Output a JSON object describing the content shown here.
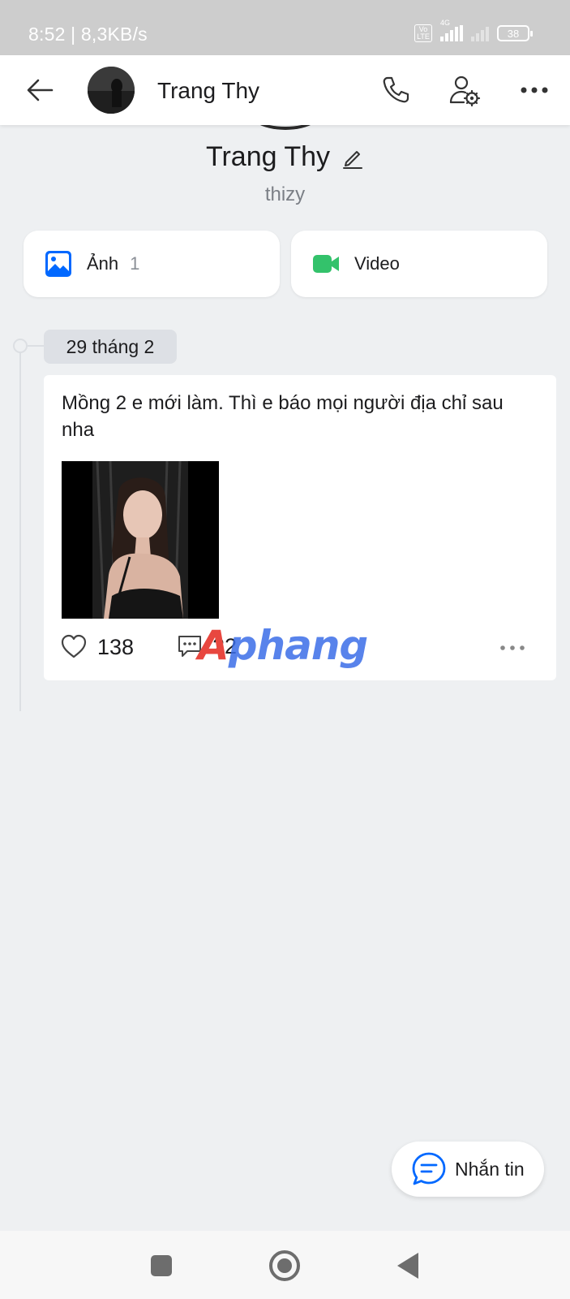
{
  "status_bar": {
    "time_speed": "8:52 | 8,3KB/s",
    "volte": "Vo LTE",
    "network": "4G",
    "battery": "38"
  },
  "header": {
    "title": "Trang Thy"
  },
  "profile": {
    "name": "Trang Thy",
    "username": "thizy"
  },
  "media": {
    "photos_label": "Ảnh",
    "photos_count": "1",
    "videos_label": "Video"
  },
  "timeline": {
    "date": "29 tháng 2"
  },
  "post": {
    "text": "Mồng 2 e mới làm. Thì e báo mọi người địa chỉ sau nha",
    "likes": "138",
    "comments": "22"
  },
  "watermark": {
    "first": "A",
    "rest": "phang"
  },
  "fab": {
    "label": "Nhắn tin"
  },
  "colors": {
    "accent": "#0068ff",
    "video": "#33c26b",
    "background": "#eef0f2"
  },
  "icons": [
    "back-arrow-icon",
    "phone-icon",
    "user-settings-icon",
    "more-icon",
    "edit-pencil-icon",
    "image-icon",
    "video-camera-icon",
    "heart-icon",
    "comment-icon",
    "chat-bubble-icon"
  ]
}
